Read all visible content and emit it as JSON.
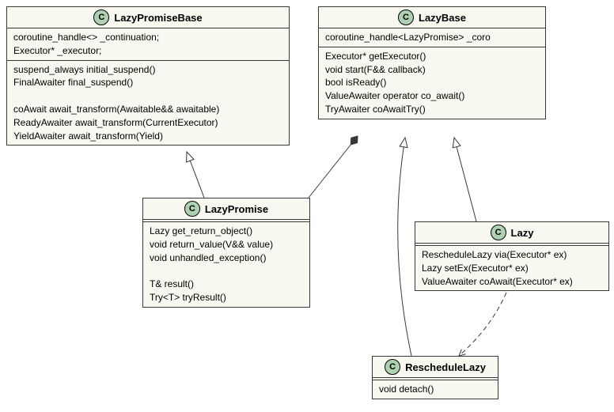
{
  "badge": "C",
  "lazyPromiseBase": {
    "name": "LazyPromiseBase",
    "fields": "coroutine_handle<> _continuation;\nExecutor* _executor;",
    "methods": "suspend_always initial_suspend()\nFinalAwaiter final_suspend()\n\ncoAwait await_transform(Awaitable&& awaitable)\nReadyAwaiter await_transform(CurrentExecutor)\nYieldAwaiter await_transform(Yield)"
  },
  "lazyBase": {
    "name": "LazyBase",
    "fields": "coroutine_handle<LazyPromise> _coro",
    "methods": "Executor* getExecutor()\nvoid start(F&& callback)\nbool isReady()\nValueAwaiter operator co_await()\nTryAwaiter coAwaitTry()"
  },
  "lazyPromise": {
    "name": "LazyPromise",
    "methods": "Lazy get_return_object()\nvoid return_value(V&& value)\nvoid unhandled_exception()\n\nT& result()\nTry<T> tryResult()"
  },
  "lazy": {
    "name": "Lazy",
    "methods": "RescheduleLazy via(Executor* ex)\nLazy setEx(Executor* ex)\nValueAwaiter coAwait(Executor* ex)"
  },
  "rescheduleLazy": {
    "name": "RescheduleLazy",
    "methods": "void detach()"
  },
  "chart_data": {
    "type": "diagram",
    "diagram_type": "UML class diagram",
    "classes": [
      {
        "name": "LazyPromiseBase",
        "fields": [
          "coroutine_handle<> _continuation;",
          "Executor* _executor;"
        ],
        "methods": [
          "suspend_always initial_suspend()",
          "FinalAwaiter final_suspend()",
          "coAwait await_transform(Awaitable&& awaitable)",
          "ReadyAwaiter await_transform(CurrentExecutor)",
          "YieldAwaiter await_transform(Yield)"
        ]
      },
      {
        "name": "LazyBase",
        "fields": [
          "coroutine_handle<LazyPromise> _coro"
        ],
        "methods": [
          "Executor* getExecutor()",
          "void start(F&& callback)",
          "bool isReady()",
          "ValueAwaiter operator co_await()",
          "TryAwaiter coAwaitTry()"
        ]
      },
      {
        "name": "LazyPromise",
        "methods": [
          "Lazy get_return_object()",
          "void return_value(V&& value)",
          "void unhandled_exception()",
          "T& result()",
          "Try<T> tryResult()"
        ]
      },
      {
        "name": "Lazy",
        "methods": [
          "RescheduleLazy via(Executor* ex)",
          "Lazy setEx(Executor* ex)",
          "ValueAwaiter coAwait(Executor* ex)"
        ]
      },
      {
        "name": "RescheduleLazy",
        "methods": [
          "void detach()"
        ]
      }
    ],
    "relationships": [
      {
        "from": "LazyPromise",
        "to": "LazyPromiseBase",
        "type": "inheritance"
      },
      {
        "from": "LazyPromise",
        "to": "LazyBase",
        "type": "composition"
      },
      {
        "from": "Lazy",
        "to": "LazyBase",
        "type": "inheritance"
      },
      {
        "from": "RescheduleLazy",
        "to": "LazyBase",
        "type": "inheritance"
      },
      {
        "from": "Lazy",
        "to": "RescheduleLazy",
        "type": "dependency"
      }
    ]
  }
}
